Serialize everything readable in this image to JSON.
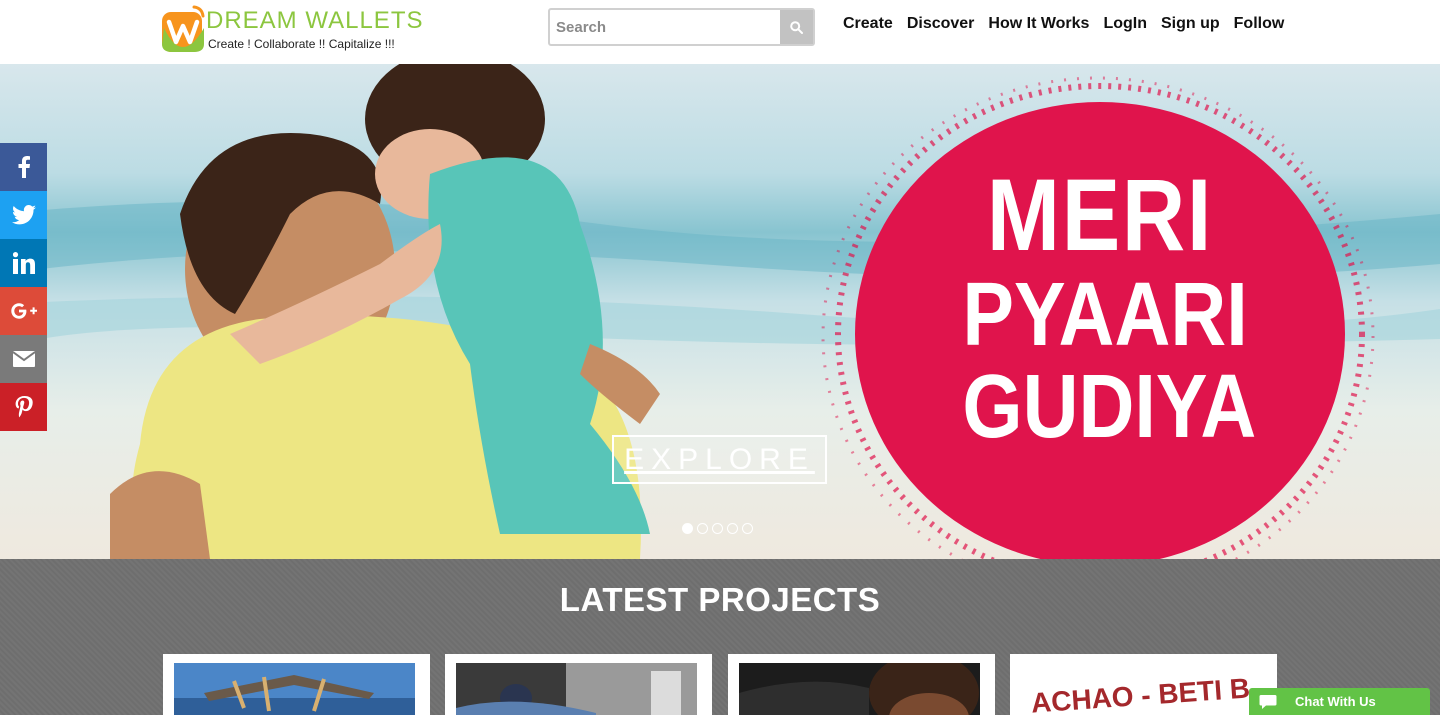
{
  "brand": {
    "name": "DREAM WALLETS",
    "tagline": "Create ! Collaborate !! Capitalize !!!",
    "colors": {
      "green": "#8cc63f",
      "orange": "#f7941d"
    }
  },
  "search": {
    "placeholder": "Search",
    "value": "",
    "icon": "search-icon"
  },
  "nav": [
    {
      "label": "Create"
    },
    {
      "label": "Discover"
    },
    {
      "label": "How It Works"
    },
    {
      "label": "LogIn"
    },
    {
      "label": "Sign up"
    },
    {
      "label": "Follow"
    }
  ],
  "social": [
    {
      "icon": "facebook-icon",
      "glyph": "f",
      "color": "#3b5998"
    },
    {
      "icon": "twitter-icon",
      "glyph": "t",
      "color": "#1da1f2"
    },
    {
      "icon": "linkedin-icon",
      "glyph": "in",
      "color": "#0077b5"
    },
    {
      "icon": "google-plus-icon",
      "glyph": "G+",
      "color": "#dd4b39"
    },
    {
      "icon": "email-icon",
      "glyph": "✉",
      "color": "#7a7a7a"
    },
    {
      "icon": "pinterest-icon",
      "glyph": "P",
      "color": "#cb2027"
    }
  ],
  "hero": {
    "slogan": [
      "MERI",
      "PYAARI",
      "GUDIYA"
    ],
    "slogan_color": "#e0144c",
    "button_label": "EXPLORE",
    "slides_total": 5,
    "active_slide": 1
  },
  "latest": {
    "title": "LATEST PROJECTS",
    "cards": [
      {
        "id": "card-1"
      },
      {
        "id": "card-2"
      },
      {
        "id": "card-3"
      },
      {
        "id": "card-4",
        "image_text": "ACHAO - BETI B"
      }
    ]
  },
  "chat": {
    "label": "Chat With Us",
    "color": "#62c346"
  }
}
